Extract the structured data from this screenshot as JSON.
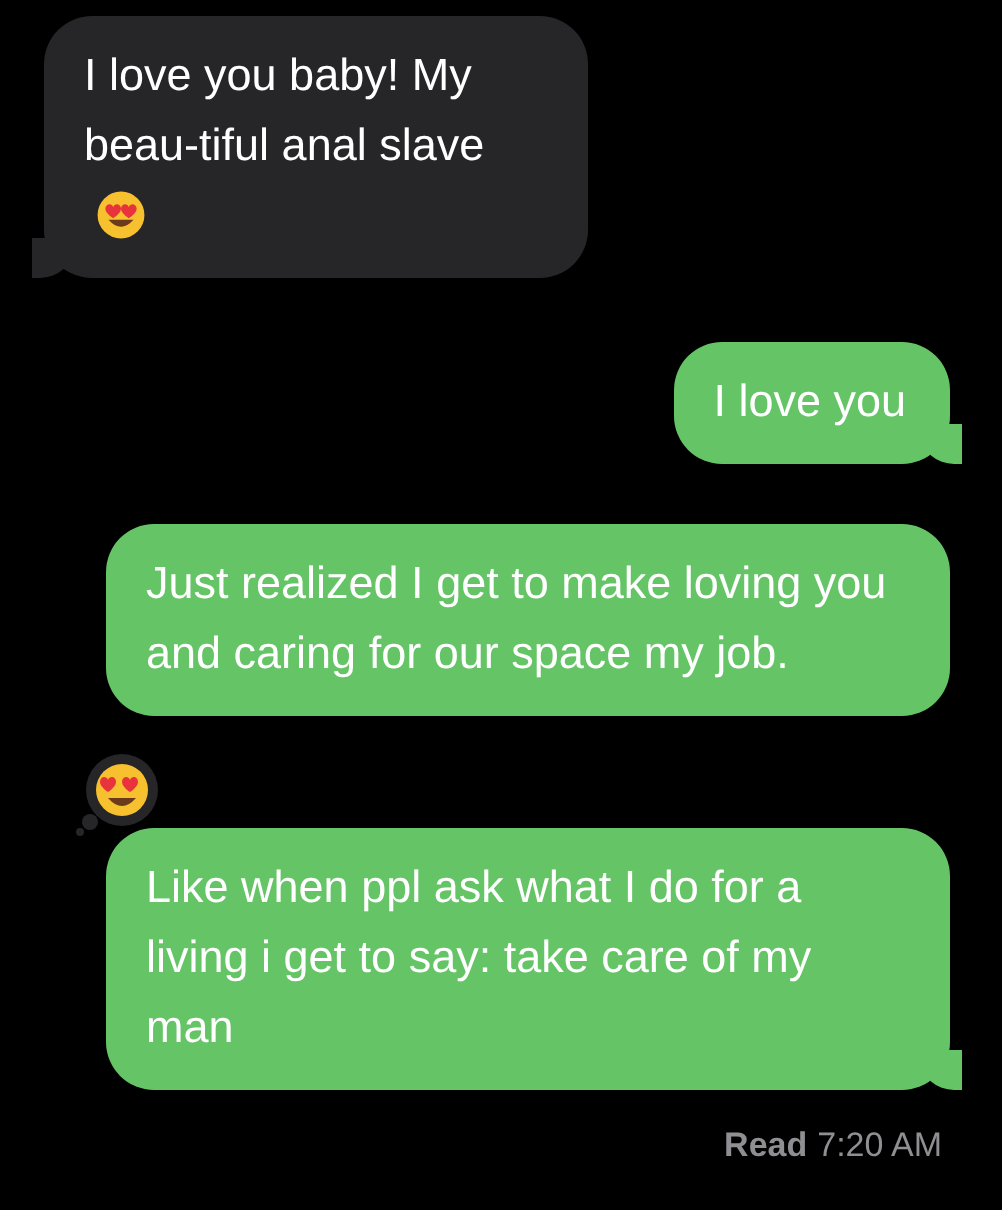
{
  "messages": [
    {
      "kind": "incoming",
      "text": "I love you baby! My beau-tiful anal slave",
      "trailing_emoji": true,
      "reaction": false,
      "tail": true
    },
    {
      "kind": "outgoing",
      "text": "I love you",
      "trailing_emoji": false,
      "reaction": false,
      "tail": true
    },
    {
      "kind": "outgoing",
      "text": "Just realized I get to make loving you and caring for our space my job.",
      "trailing_emoji": false,
      "reaction": false,
      "tail": false
    },
    {
      "kind": "outgoing",
      "text": "Like when ppl ask what I do for a living i get to say: take care of my man",
      "trailing_emoji": false,
      "reaction": true,
      "tail": true
    }
  ],
  "receipt": {
    "label": "Read",
    "time": "7:20 AM"
  }
}
